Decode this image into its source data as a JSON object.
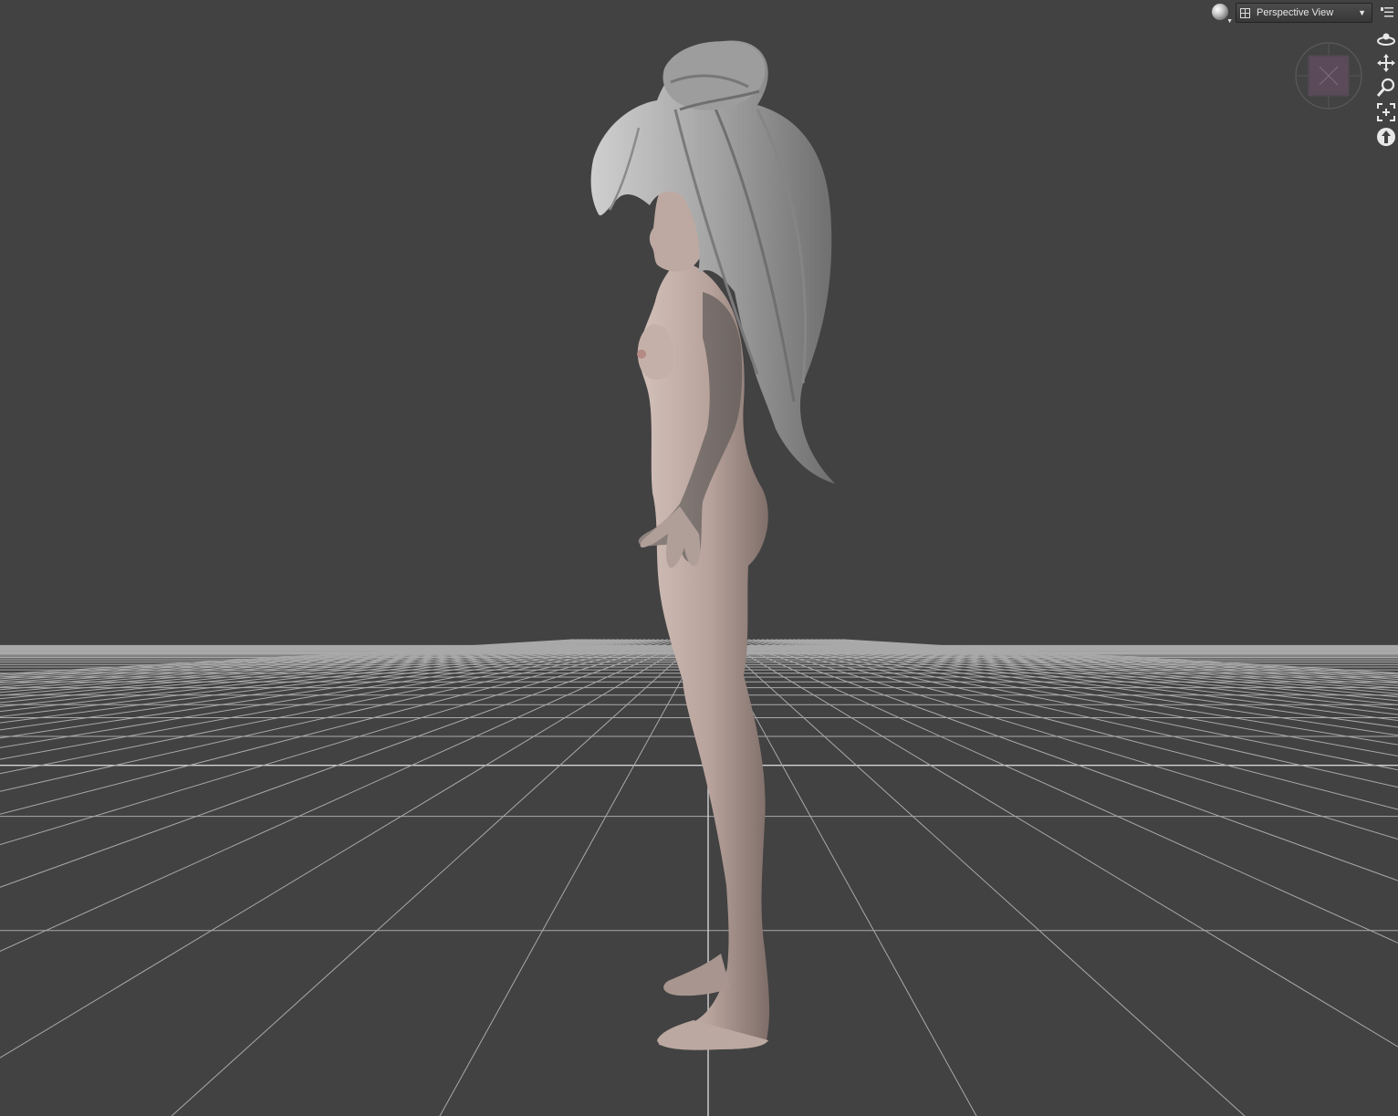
{
  "viewport": {
    "view_name": "Perspective View",
    "background_color": "#424242",
    "grid_color": "#a9a9a9",
    "axis_color": "#d4d4d4",
    "skin_color": "#b49f98",
    "hair_color": "#9a9a9a"
  },
  "toolbar": {
    "draw_style_icon": "sphere-shading-icon",
    "view_icon": "viewport-layout-icon",
    "dropdown_icon": "chevron-down-icon",
    "menu_icon": "options-menu-icon",
    "dropdown_glyph": "▼",
    "caret_glyph": "▼"
  },
  "nav_cube": {
    "icon": "view-cube-icon"
  },
  "nav_tools": [
    {
      "name": "orbit-icon"
    },
    {
      "name": "pan-icon"
    },
    {
      "name": "zoom-icon"
    },
    {
      "name": "frame-icon"
    },
    {
      "name": "reset-view-icon"
    }
  ]
}
